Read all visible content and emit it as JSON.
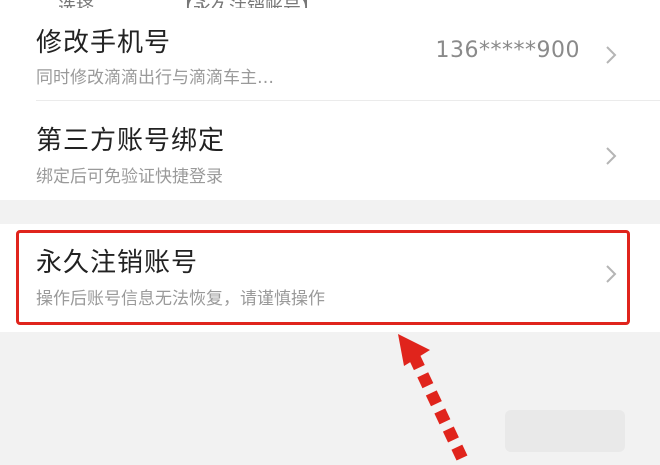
{
  "top_cut_text": "—选择　　　　　【永久注销账号】",
  "settings": {
    "rows": [
      {
        "title": "修改手机号",
        "subtitle": "同时修改滴滴出行与滴滴车主…",
        "value": "136*****900",
        "chevron": ">"
      },
      {
        "title": "第三方账号绑定",
        "subtitle": "绑定后可免验证快捷登录",
        "value": "",
        "chevron": ">"
      },
      {
        "title": "永久注销账号",
        "subtitle": "操作后账号信息无法恢复，请谨慎操作",
        "value": "",
        "chevron": ">"
      }
    ]
  },
  "annotation": {
    "highlight_color": "#e0241c",
    "arrow_color": "#e0241c",
    "arrow_icon": "pointer-arrow-icon"
  },
  "colors": {
    "background": "#f2f2f2",
    "row_background": "#ffffff",
    "title": "#222222",
    "subtitle": "#9a9a9a"
  }
}
